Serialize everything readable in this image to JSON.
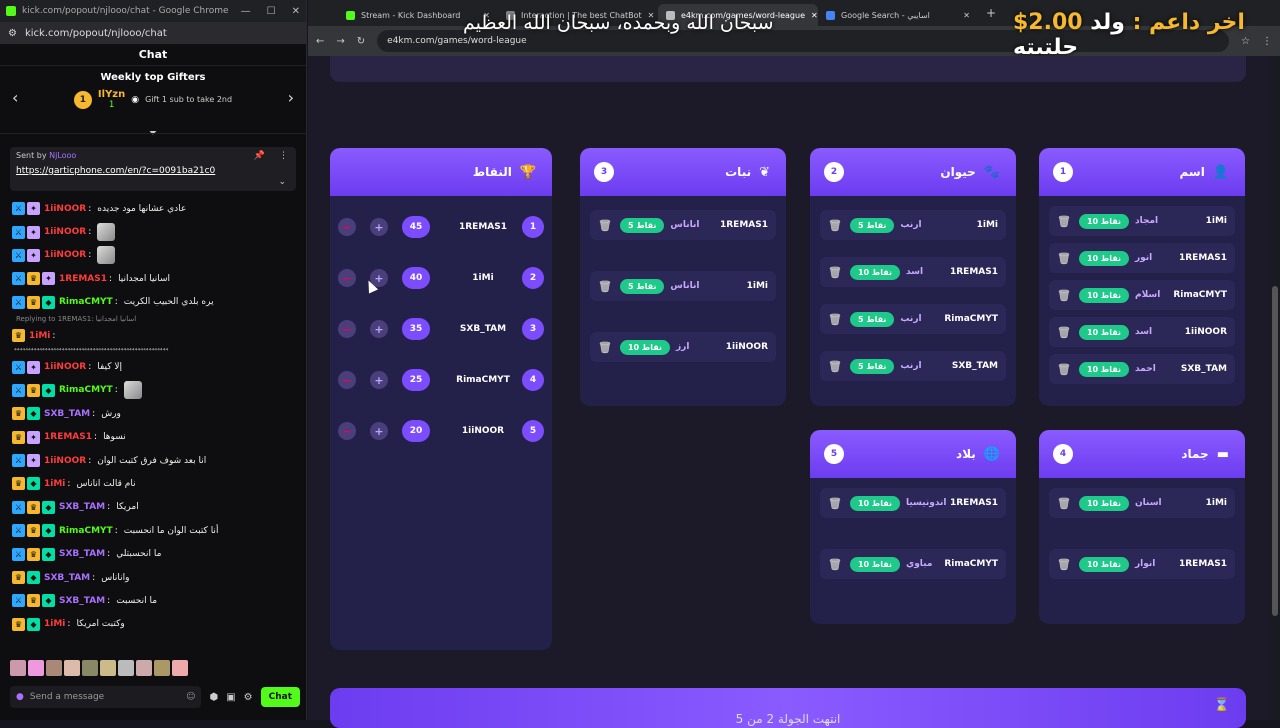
{
  "left_window": {
    "title": "kick.com/popout/njlooo/chat - Google Chrome",
    "url": "kick.com/popout/njlooo/chat",
    "chat_header": "Chat",
    "gifters_title": "Weekly top Gifters",
    "top_gifter": {
      "rank": "1",
      "name": "IlYzn",
      "subs": "1",
      "note": "Gift 1 sub to take 2nd"
    },
    "pinned": {
      "sent_by_label": "Sent by",
      "sent_by": "NjLooo",
      "link": "https://garticphone.com/en/?c=0091ba21c0"
    },
    "messages": [
      {
        "badges": [
          "mod",
          "vip"
        ],
        "user": "1iiNOOR",
        "color": "#ff3b3b",
        "text": "عادي عشانها مود جديده",
        "emote": false
      },
      {
        "badges": [
          "mod",
          "vip"
        ],
        "user": "1iiNOOR",
        "color": "#ff3b3b",
        "text": "",
        "emote": true
      },
      {
        "badges": [
          "mod",
          "vip"
        ],
        "user": "1iiNOOR",
        "color": "#ff3b3b",
        "text": "",
        "emote": true
      },
      {
        "badges": [
          "mod",
          "crown",
          "vip"
        ],
        "user": "1REMAS1",
        "color": "#ff3b3b",
        "text": "اسانيا امجدانيا",
        "emote": false
      },
      {
        "badges": [
          "mod",
          "crown",
          "sub"
        ],
        "user": "RimaCMYT",
        "color": "#53fc18",
        "text": "يره بلدي الحبيب الكريت",
        "emote": false
      },
      {
        "badges": [
          "crown"
        ],
        "user": "1iMi",
        "color": "#ff3b3b",
        "text": "",
        "emote": false,
        "reply": "Replying to 1REMAS1: اسانيا امجدانيا",
        "dots": "⁴⁴⁴⁴⁴⁴⁴⁴⁴⁴⁴⁴⁴⁴⁴⁴⁴⁴⁴⁴⁴⁴⁴⁴⁴⁴⁴⁴⁴⁴⁴⁴⁴⁴⁴⁴⁴⁴⁴⁴⁴⁴⁴⁴⁴⁴⁴⁴⁴⁴⁴⁴⁴⁴⁴"
      },
      {
        "badges": [
          "mod",
          "vip"
        ],
        "user": "1iiNOOR",
        "color": "#ff3b3b",
        "text": "إلا كيفا",
        "emote": false
      },
      {
        "badges": [
          "mod",
          "crown",
          "sub"
        ],
        "user": "RimaCMYT",
        "color": "#53fc18",
        "text": "",
        "emote": true
      },
      {
        "badges": [
          "crown",
          "sub"
        ],
        "user": "SXB_TAM",
        "color": "#a970ff",
        "text": "ورش",
        "emote": false
      },
      {
        "badges": [
          "crown",
          "vip"
        ],
        "user": "1REMAS1",
        "color": "#ff3b3b",
        "text": "نسوها",
        "emote": false
      },
      {
        "badges": [
          "mod",
          "vip"
        ],
        "user": "1iiNOOR",
        "color": "#ff3b3b",
        "text": "انا بعد شوف فرق كتبت الوان",
        "emote": false
      },
      {
        "badges": [
          "crown",
          "sub"
        ],
        "user": "1iMi",
        "color": "#ff3b3b",
        "text": "نام قالت اناناس",
        "emote": false
      },
      {
        "badges": [
          "mod",
          "crown",
          "sub"
        ],
        "user": "SXB_TAM",
        "color": "#a970ff",
        "text": "امريكا",
        "emote": false
      },
      {
        "badges": [
          "mod",
          "crown",
          "sub"
        ],
        "user": "RimaCMYT",
        "color": "#53fc18",
        "text": "أنا كتبت الوان ما انحسبت",
        "emote": false
      },
      {
        "badges": [
          "mod",
          "crown",
          "sub"
        ],
        "user": "SXB_TAM",
        "color": "#a970ff",
        "text": "ما انحسبتلي",
        "emote": false
      },
      {
        "badges": [
          "crown",
          "sub"
        ],
        "user": "SXB_TAM",
        "color": "#a970ff",
        "text": "واناناس",
        "emote": false
      },
      {
        "badges": [
          "mod",
          "crown",
          "sub"
        ],
        "user": "SXB_TAM",
        "color": "#a970ff",
        "text": "ما انحسبت",
        "emote": false
      },
      {
        "badges": [
          "crown",
          "sub"
        ],
        "user": "1iMi",
        "color": "#ff3b3b",
        "text": "وكتبت امريكا",
        "emote": false
      }
    ],
    "send_placeholder": "Send a message",
    "chat_button": "Chat"
  },
  "right_window": {
    "tabs": [
      {
        "label": "Stream - Kick Dashboard",
        "icon_color": "#53fc18",
        "active": false
      },
      {
        "label": "Interaction | The best ChatBot",
        "icon_color": "#888888",
        "active": false
      },
      {
        "label": "e4km.com/games/word-league",
        "icon_color": "#bbbbbb",
        "active": true
      },
      {
        "label": "Google Search - اسايبي",
        "icon_color": "#4285f4",
        "active": false
      }
    ],
    "address": "e4km.com/games/word-league",
    "overlay_text": "سبحان الله وبحمده، سبحان الله العظيم",
    "overlay_price_prefix": "ولد حلتيته",
    "overlay_price_label": "اخر داعم :",
    "overlay_price_value": "$2.00",
    "leaderboard": {
      "title": "النقاط",
      "title_icon": "trophy-icon",
      "rows": [
        {
          "rank": "1",
          "name": "1REMAS1",
          "score": "45"
        },
        {
          "rank": "2",
          "name": "1iMi",
          "score": "40"
        },
        {
          "rank": "3",
          "name": "SXB_TAM",
          "score": "35"
        },
        {
          "rank": "4",
          "name": "RimaCMYT",
          "score": "25"
        },
        {
          "rank": "5",
          "name": "1iiNOOR",
          "score": "20"
        }
      ]
    },
    "categories": [
      {
        "id": "3",
        "title": "نبات",
        "icon": "leaf-icon",
        "rows": [
          {
            "player": "1REMAS1",
            "word": "اناناس",
            "points": "5 نقاط"
          },
          {
            "player": "1iMi",
            "word": "اناناس",
            "points": "5 نقاط"
          },
          {
            "player": "1iiNOOR",
            "word": "ارز",
            "points": "10 نقاط"
          }
        ]
      },
      {
        "id": "2",
        "title": "حيوان",
        "icon": "paw-icon",
        "rows": [
          {
            "player": "1iMi",
            "word": "ارنب",
            "points": "5 نقاط"
          },
          {
            "player": "1REMAS1",
            "word": "اسد",
            "points": "10 نقاط"
          },
          {
            "player": "RimaCMYT",
            "word": "ارنب",
            "points": "5 نقاط"
          },
          {
            "player": "SXB_TAM",
            "word": "ارنب",
            "points": "5 نقاط"
          }
        ]
      },
      {
        "id": "1",
        "title": "اسم",
        "icon": "person-icon",
        "rows": [
          {
            "player": "1iMi",
            "word": "امجاد",
            "points": "10 نقاط"
          },
          {
            "player": "1REMAS1",
            "word": "انور",
            "points": "10 نقاط"
          },
          {
            "player": "RimaCMYT",
            "word": "اسلام",
            "points": "10 نقاط"
          },
          {
            "player": "1iiNOOR",
            "word": "اسد",
            "points": "10 نقاط"
          },
          {
            "player": "SXB_TAM",
            "word": "احمد",
            "points": "10 نقاط"
          }
        ]
      },
      {
        "id": "5",
        "title": "بلاد",
        "icon": "globe-icon",
        "rows": [
          {
            "player": "1REMAS1",
            "word": "اندونيسيا",
            "points": "10 نقاط"
          },
          {
            "player": "RimaCMYT",
            "word": "مباوي",
            "points": "10 نقاط"
          }
        ]
      },
      {
        "id": "4",
        "title": "جماد",
        "icon": "object-icon",
        "rows": [
          {
            "player": "1iMi",
            "word": "اسنان",
            "points": "10 نقاط"
          },
          {
            "player": "1REMAS1",
            "word": "انوار",
            "points": "10 نقاط"
          }
        ]
      }
    ],
    "bottom_banner": "انتهت الجولة 2 من 5"
  }
}
